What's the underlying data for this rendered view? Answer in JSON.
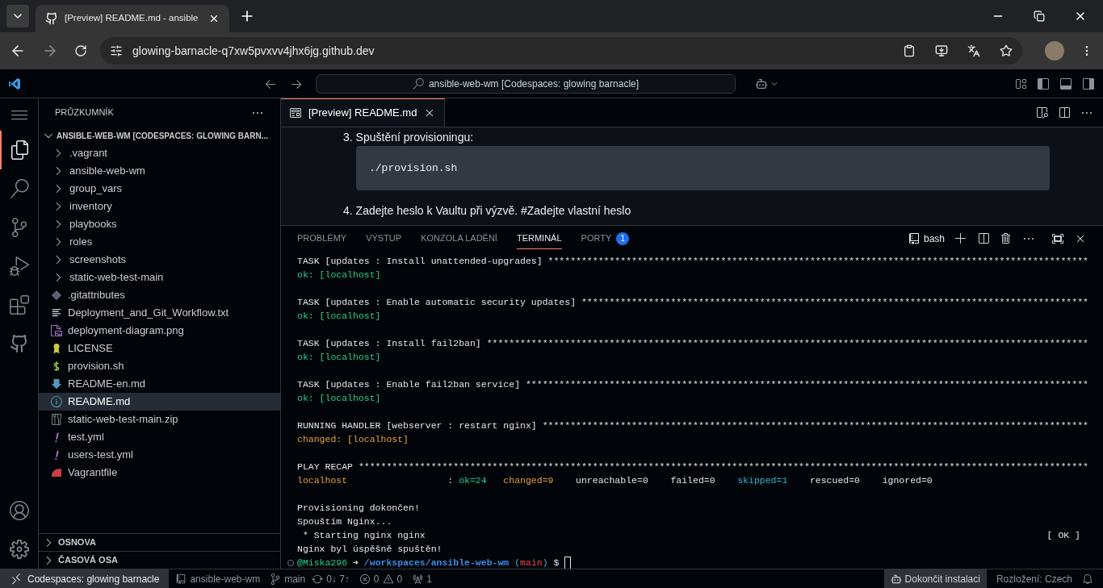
{
  "browser": {
    "tab": {
      "title": "[Preview] README.md - ansible"
    },
    "address": "glowing-barnacle-q7xw5pvxvv4jhx6jg.github.dev"
  },
  "titlebar": {
    "command_center": "ansible-web-wm [Codespaces: glowing barnacle]"
  },
  "sidebar": {
    "title": "PRŮZKUMNÍK",
    "root": "ANSIBLE-WEB-WM [CODESPACES: GLOWING BARN...",
    "items": [
      {
        "label": ".vagrant",
        "kind": "folder",
        "selected": false
      },
      {
        "label": "ansible-web-wm",
        "kind": "folder",
        "selected": false
      },
      {
        "label": "group_vars",
        "kind": "folder",
        "selected": false
      },
      {
        "label": "inventory",
        "kind": "folder",
        "selected": false
      },
      {
        "label": "playbooks",
        "kind": "folder",
        "selected": false
      },
      {
        "label": "roles",
        "kind": "folder",
        "selected": false
      },
      {
        "label": "screenshots",
        "kind": "folder",
        "selected": false
      },
      {
        "label": "static-web-test-main",
        "kind": "folder",
        "selected": false
      },
      {
        "label": ".gitattributes",
        "kind": "git",
        "selected": false
      },
      {
        "label": "Deployment_and_Git_Workflow.txt",
        "kind": "text",
        "selected": false
      },
      {
        "label": "deployment-diagram.png",
        "kind": "image",
        "selected": false
      },
      {
        "label": "LICENSE",
        "kind": "license",
        "selected": false
      },
      {
        "label": "provision.sh",
        "kind": "shell",
        "selected": false
      },
      {
        "label": "README-en.md",
        "kind": "markdown",
        "selected": false
      },
      {
        "label": "README.md",
        "kind": "info",
        "selected": true
      },
      {
        "label": "static-web-test-main.zip",
        "kind": "zip",
        "selected": false
      },
      {
        "label": "test.yml",
        "kind": "yaml",
        "selected": false
      },
      {
        "label": "users-test.yml",
        "kind": "yaml",
        "selected": false
      },
      {
        "label": "Vagrantfile",
        "kind": "vagrant",
        "selected": false
      }
    ],
    "sections": [
      "OSNOVA",
      "ČASOVÁ OSA"
    ]
  },
  "editor": {
    "tab": "[Preview] README.md",
    "steps": [
      {
        "number": "3.",
        "text": "Spuštění provisioningu:",
        "code": "./provision.sh"
      },
      {
        "number": "4.",
        "text": "Zadejte heslo k Vaultu při výzvě. #Zadejte vlastní heslo"
      }
    ]
  },
  "panel": {
    "tabs": [
      {
        "label": "PROBLÉMY",
        "selected": false
      },
      {
        "label": "VÝSTUP",
        "selected": false
      },
      {
        "label": "KONZOLA LADĚNÍ",
        "selected": false
      },
      {
        "label": "TERMINÁL",
        "selected": true
      },
      {
        "label": "PORTY",
        "selected": false,
        "badge": "1"
      }
    ],
    "shell": "bash",
    "terminal": {
      "blocks": [
        [
          {
            "kind": "task",
            "text": "TASK [updates : Install unattended-upgrades] *************************************************************************************************"
          },
          {
            "kind": "ok",
            "text": "ok: [localhost]"
          }
        ],
        [
          {
            "kind": "task",
            "text": "TASK [updates : Enable automatic security updates] *******************************************************************************************"
          },
          {
            "kind": "ok",
            "text": "ok: [localhost]"
          }
        ],
        [
          {
            "kind": "task",
            "text": "TASK [updates : Install fail2ban] ************************************************************************************************************"
          },
          {
            "kind": "ok",
            "text": "ok: [localhost]"
          }
        ],
        [
          {
            "kind": "task",
            "text": "TASK [updates : Enable fail2ban service] *****************************************************************************************************"
          },
          {
            "kind": "ok",
            "text": "ok: [localhost]"
          }
        ],
        [
          {
            "kind": "task",
            "text": "RUNNING HANDLER [webserver : restart nginx] **************************************************************************************************"
          },
          {
            "kind": "changed",
            "text": "changed: [localhost]"
          }
        ],
        [
          {
            "kind": "task",
            "text": "PLAY RECAP ***********************************************************************************************************************************"
          }
        ]
      ],
      "recap": [
        {
          "kind": "host",
          "text": "localhost"
        },
        {
          "kind": "plain",
          "text": ":"
        },
        {
          "kind": "ok",
          "text": "ok=24"
        },
        {
          "kind": "changed",
          "text": "changed=9"
        },
        {
          "kind": "plain",
          "text": "unreachable=0"
        },
        {
          "kind": "plain",
          "text": "failed=0"
        },
        {
          "kind": "skipped",
          "text": "skipped=1"
        },
        {
          "kind": "plain",
          "text": "rescued=0"
        },
        {
          "kind": "plain",
          "text": "ignored=0"
        }
      ],
      "output": [
        {
          "text": "Provisioning dokončen!"
        },
        {
          "text": "Spouštím Nginx..."
        },
        {
          "text": " * Starting nginx nginx",
          "status": "[ OK ]"
        },
        {
          "text": "Nginx byl úspěšně spuštěn!"
        }
      ],
      "prompt": [
        {
          "kind": "user",
          "text": "@Miska296"
        },
        {
          "kind": "arrow",
          "text": "➜"
        },
        {
          "kind": "path",
          "text": "/workspaces/ansible-web-wm"
        },
        {
          "kind": "paren",
          "text": "("
        },
        {
          "kind": "branch",
          "text": "main"
        },
        {
          "kind": "paren",
          "text": ")"
        },
        {
          "kind": "plain",
          "text": "$"
        }
      ]
    }
  },
  "statusbar": {
    "remote": "Codespaces: glowing barnacle",
    "repo": "ansible-web-wm",
    "branch": "main",
    "sync": "0↓ 7↑",
    "errors": "0",
    "warnings": "0",
    "ports": "1",
    "install": "Dokončit instalaci",
    "layout": "Rozložení: Czech"
  }
}
